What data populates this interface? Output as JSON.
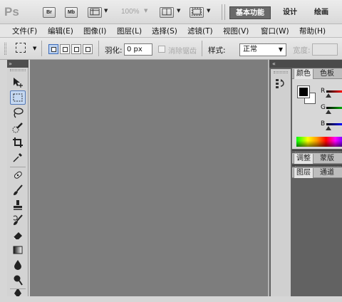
{
  "app": {
    "logo": "Ps",
    "bridge_label": "Br",
    "minibridge_label": "Mb",
    "zoom": "100%",
    "workspaces": [
      "基本功能",
      "设计",
      "绘画"
    ]
  },
  "menu": [
    "文件(F)",
    "编辑(E)",
    "图像(I)",
    "图层(L)",
    "选择(S)",
    "滤镜(T)",
    "视图(V)",
    "窗口(W)",
    "帮助(H)"
  ],
  "options": {
    "feather_label": "羽化:",
    "feather_value": "0 px",
    "antialias_label": "消除锯齿",
    "style_label": "样式:",
    "style_value": "正常",
    "width_label": "宽度:"
  },
  "toolbox": {
    "collapse": "»",
    "tools": [
      "move-tool",
      "rectangular-marquee-tool",
      "lasso-tool",
      "quick-selection-tool",
      "crop-tool",
      "eyedropper-tool",
      "spot-healing-brush-tool",
      "brush-tool",
      "clone-stamp-tool",
      "history-brush-tool",
      "eraser-tool",
      "gradient-tool",
      "blur-tool",
      "dodge-tool",
      "pen-tool"
    ]
  },
  "dock": {
    "collapse": "«"
  },
  "panels": {
    "color_tabs": [
      "颜色",
      "色板"
    ],
    "channels": [
      "R",
      "G",
      "B"
    ],
    "adjust_tabs": [
      "调整",
      "蒙版"
    ],
    "layer_tabs": [
      "图层",
      "通道"
    ]
  },
  "colors": {
    "canvas": "#7d7d7d",
    "active_workspace": "#6a6a6a",
    "foreground": "#000000",
    "background": "#ffffff"
  }
}
